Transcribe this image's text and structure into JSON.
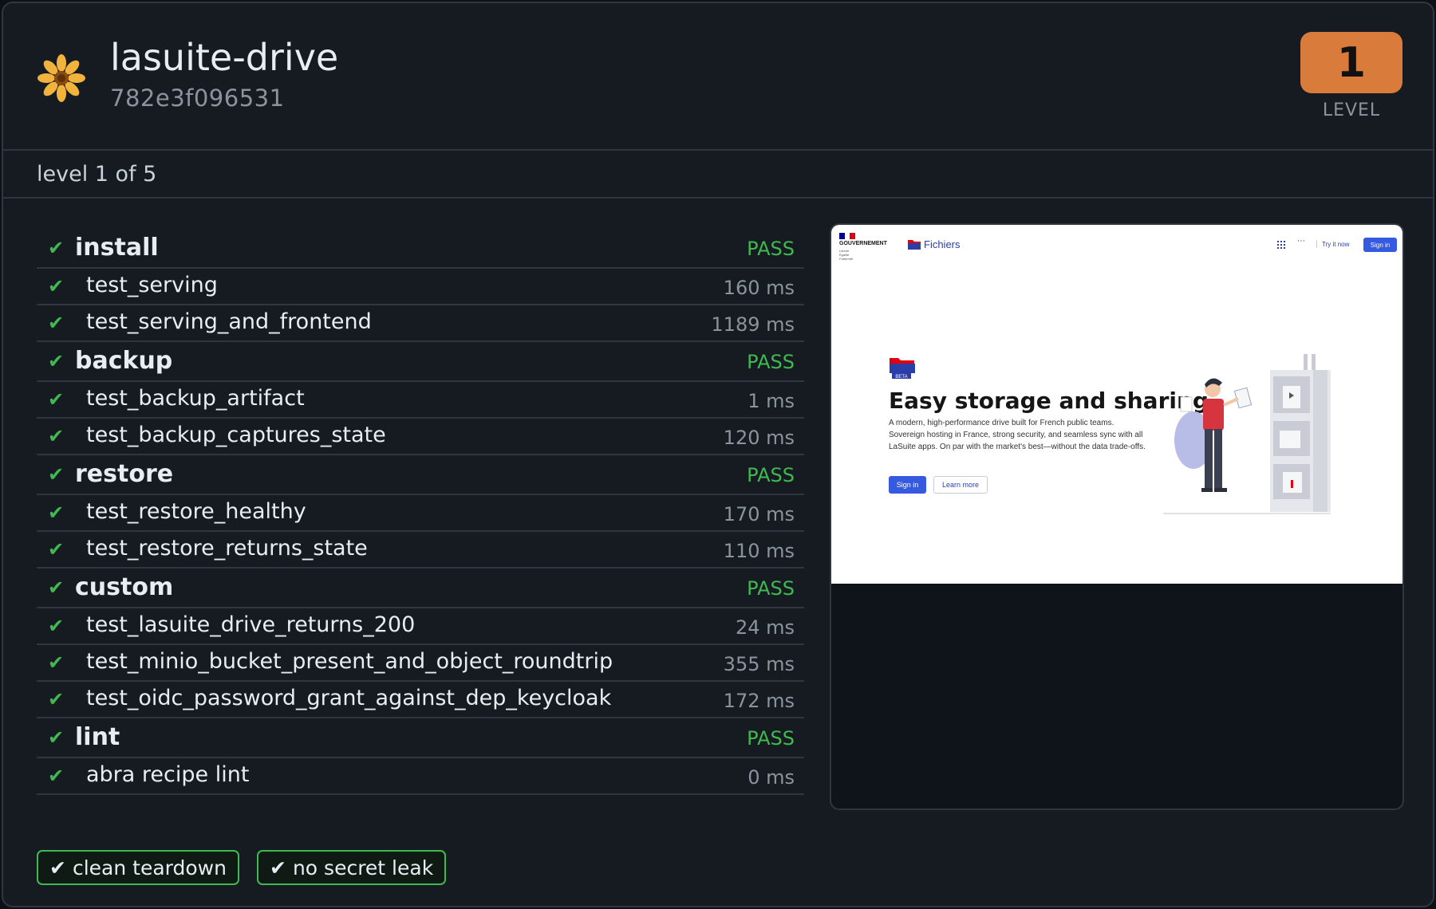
{
  "app": {
    "title": "lasuite-drive",
    "id": "782e3f096531",
    "logo_icon": "sunflower-icon"
  },
  "level": {
    "value": "1",
    "caption": "LEVEL",
    "progress_text": "level 1 of 5"
  },
  "groups": [
    {
      "name": "install",
      "status": "PASS",
      "tests": [
        {
          "name": "test_serving",
          "time": "160 ms"
        },
        {
          "name": "test_serving_and_frontend",
          "time": "1189 ms"
        }
      ]
    },
    {
      "name": "backup",
      "status": "PASS",
      "tests": [
        {
          "name": "test_backup_artifact",
          "time": "1 ms"
        },
        {
          "name": "test_backup_captures_state",
          "time": "120 ms"
        }
      ]
    },
    {
      "name": "restore",
      "status": "PASS",
      "tests": [
        {
          "name": "test_restore_healthy",
          "time": "170 ms"
        },
        {
          "name": "test_restore_returns_state",
          "time": "110 ms"
        }
      ]
    },
    {
      "name": "custom",
      "status": "PASS",
      "tests": [
        {
          "name": "test_lasuite_drive_returns_200",
          "time": "24 ms"
        },
        {
          "name": "test_minio_bucket_present_and_object_roundtrip",
          "time": "355 ms"
        },
        {
          "name": "test_oidc_password_grant_against_dep_keycloak",
          "time": "172 ms"
        }
      ]
    },
    {
      "name": "lint",
      "status": "PASS",
      "tests": [
        {
          "name": "abra recipe lint",
          "time": "0 ms"
        }
      ]
    }
  ],
  "check_glyph": "✔",
  "preview": {
    "gov_label": "GOUVERNEMENT",
    "gov_motto": [
      "Liberté",
      "Égalité",
      "Fraternité"
    ],
    "site_name": "Fichiers",
    "nav_try": "Try it now",
    "nav_signin": "Sign in",
    "beta_label": "BETA",
    "hero_title": "Easy storage and sharing",
    "hero_desc": "A modern, high-performance drive built for French public teams. Sovereign hosting in France, strong security, and seamless sync with all LaSuite apps. On par with the market's best—without the data trade-offs.",
    "hero_btn_primary": "Sign in",
    "hero_btn_secondary": "Learn more"
  },
  "footer": {
    "badges": [
      "clean teardown",
      "no secret leak"
    ]
  },
  "colors": {
    "pass": "#3fb950",
    "level_badge": "#d97b3a",
    "background": "#161b22",
    "accent_blue": "#3559e0"
  }
}
